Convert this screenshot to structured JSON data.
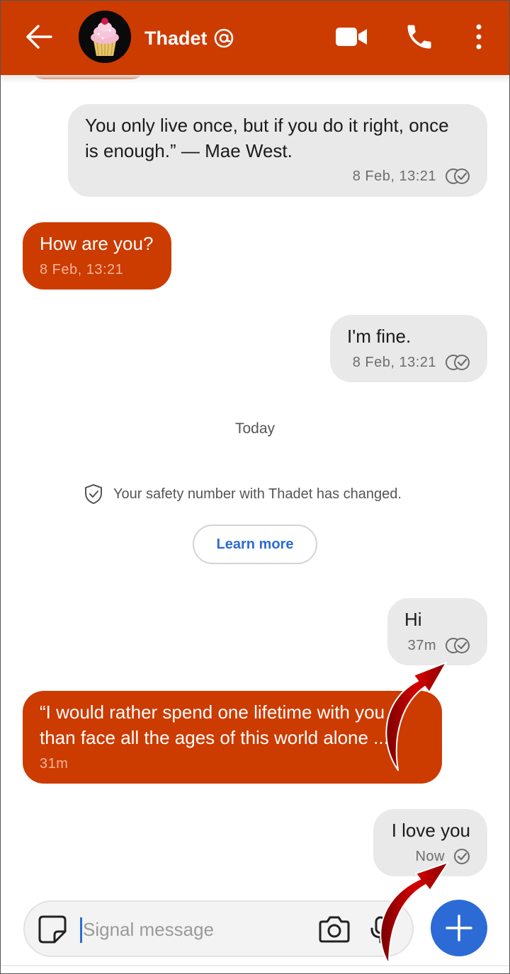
{
  "header": {
    "title": "Thadet",
    "back_icon": "arrow-left-icon",
    "verified_icon": "at-sign-icon",
    "video_icon": "video-camera-icon",
    "call_icon": "phone-icon",
    "menu_icon": "more-vertical-icon",
    "background": "#cc3b00"
  },
  "conversation": {
    "messages": [
      {
        "direction": "outgoing",
        "text_line1": "You only live once, but if you do it right, once",
        "text_line2": "is enough.” — Mae West.",
        "time": "8 Feb, 13:21",
        "status_icon": "read-double-check-icon"
      },
      {
        "direction": "incoming",
        "text": "How are you?",
        "time": "8 Feb, 13:21"
      },
      {
        "direction": "outgoing",
        "text": "I'm fine.",
        "time": "8 Feb, 13:21",
        "status_icon": "read-double-check-icon"
      },
      {
        "direction": "outgoing",
        "text": "Hi",
        "time": "37m",
        "status_icon": "read-double-check-icon"
      },
      {
        "direction": "incoming",
        "text_line1": "“I would rather spend one lifetime with you",
        "text_line2": "than face all the ages of this world alone ...",
        "time": "31m"
      },
      {
        "direction": "outgoing",
        "text": "I love you",
        "time": "Now",
        "status_icon": "sent-check-icon"
      }
    ],
    "date_divider": "Today",
    "safety_notice": {
      "icon": "shield-check-icon",
      "text": "Your safety number with Thadet has changed.",
      "button_label": "Learn more"
    }
  },
  "composer": {
    "placeholder": "Signal message",
    "value": "",
    "sticker_icon": "sticker-icon",
    "camera_icon": "camera-icon",
    "mic_icon": "microphone-icon",
    "attach_icon": "plus-icon"
  },
  "colors": {
    "accent": "#cc3b00",
    "outgoing_bubble": "#e9e9e9",
    "link": "#2c6bd6",
    "annotation_arrow": "#c00000"
  }
}
